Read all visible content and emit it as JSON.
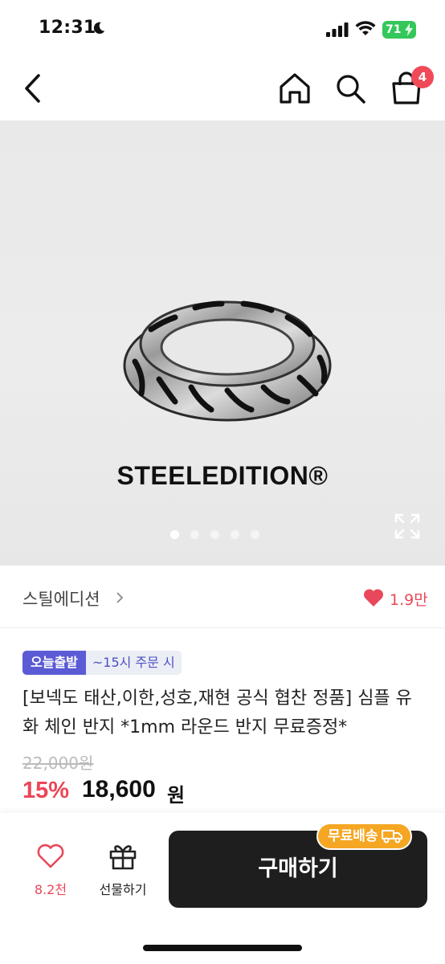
{
  "status_bar": {
    "time": "12:31",
    "battery": "71"
  },
  "nav": {
    "cart_count": "4"
  },
  "hero": {
    "brand_text": "STEELEDITION®",
    "slide_count": 5,
    "active_slide": 1
  },
  "store": {
    "name": "스틸에디션",
    "likes": "1.9만"
  },
  "product": {
    "tag_today": "오늘출발",
    "tag_cutoff": "~15시 주문 시",
    "title": "[보넥도 태산,이한,성호,재현 공식 협찬 정품] 심플 유화 체인 반지 *1mm 라운드 반지 무료증정*",
    "original_price": "22,000원",
    "discount": "15%",
    "price": "18,600",
    "price_unit": "원"
  },
  "bottom_bar": {
    "wish_count": "8.2천",
    "gift_label": "선물하기",
    "buy_label": "구매하기",
    "free_shipping": "무료배송"
  },
  "colors": {
    "accent_pink": "#ec4657",
    "tag_purple": "#5b5bd6",
    "shipping_orange": "#f5a623",
    "battery_green": "#34c759"
  }
}
